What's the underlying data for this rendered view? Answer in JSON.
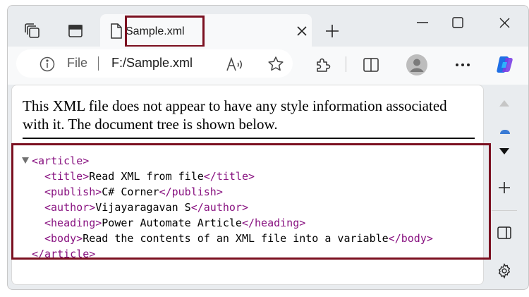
{
  "tab": {
    "title": "Sample.xml"
  },
  "address_bar": {
    "scheme_label": "File",
    "url": "F:/Sample.xml"
  },
  "page": {
    "notice": "This XML file does not appear to have any style information associated with it. The document tree is shown below.",
    "xml_lines": [
      {
        "open": "<article>",
        "text": "",
        "close": ""
      },
      {
        "open": "<title>",
        "text": "Read XML from file",
        "close": "</title>"
      },
      {
        "open": "<publish>",
        "text": "C# Corner",
        "close": "</publish>"
      },
      {
        "open": "<author>",
        "text": "Vijayaragavan S",
        "close": "</author>"
      },
      {
        "open": "<heading>",
        "text": "Power Automate Article",
        "close": "</heading>"
      },
      {
        "open": "<body>",
        "text": "Read the contents of an XML file into a variable",
        "close": "</body>"
      },
      {
        "open": "",
        "text": "",
        "close": "</article>"
      }
    ]
  },
  "colors": {
    "tag": "#881280",
    "highlight_border": "#7b1020",
    "copilot_blue": "#1f6fe5"
  },
  "icons": [
    "workspaces-icon",
    "vertical-tabs-icon",
    "page-icon",
    "close-icon",
    "new-tab-icon",
    "minimize-icon",
    "maximize-icon",
    "window-close-icon",
    "info-icon",
    "read-aloud-icon",
    "favorite-star-icon",
    "extensions-icon",
    "split-screen-icon",
    "profile-avatar-icon",
    "more-icon",
    "copilot-icon",
    "scroll-up-icon",
    "collapse-sidebar-icon",
    "add-icon",
    "hide-sidebar-icon",
    "settings-gear-icon"
  ]
}
